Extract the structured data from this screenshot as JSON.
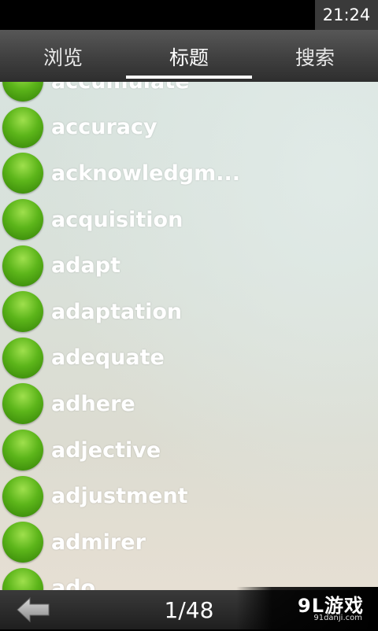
{
  "status_bar": {
    "time": "21:24"
  },
  "tabs": [
    {
      "label": "浏览",
      "active": false
    },
    {
      "label": "标题",
      "active": true
    },
    {
      "label": "搜索",
      "active": false
    }
  ],
  "list": {
    "items": [
      "accumulate",
      "accuracy",
      "acknowledgm...",
      "acquisition",
      "adapt",
      "adaptation",
      "adequate",
      "adhere",
      "adjective",
      "adjustment",
      "admirer",
      "ado"
    ]
  },
  "bottom_bar": {
    "page": "1/48"
  },
  "watermark": {
    "logo": "9L游戏",
    "url": "91danji.com"
  },
  "colors": {
    "accent_green": "#5cb51a",
    "tab_bar": "#474747",
    "status_bar": "#000000"
  }
}
